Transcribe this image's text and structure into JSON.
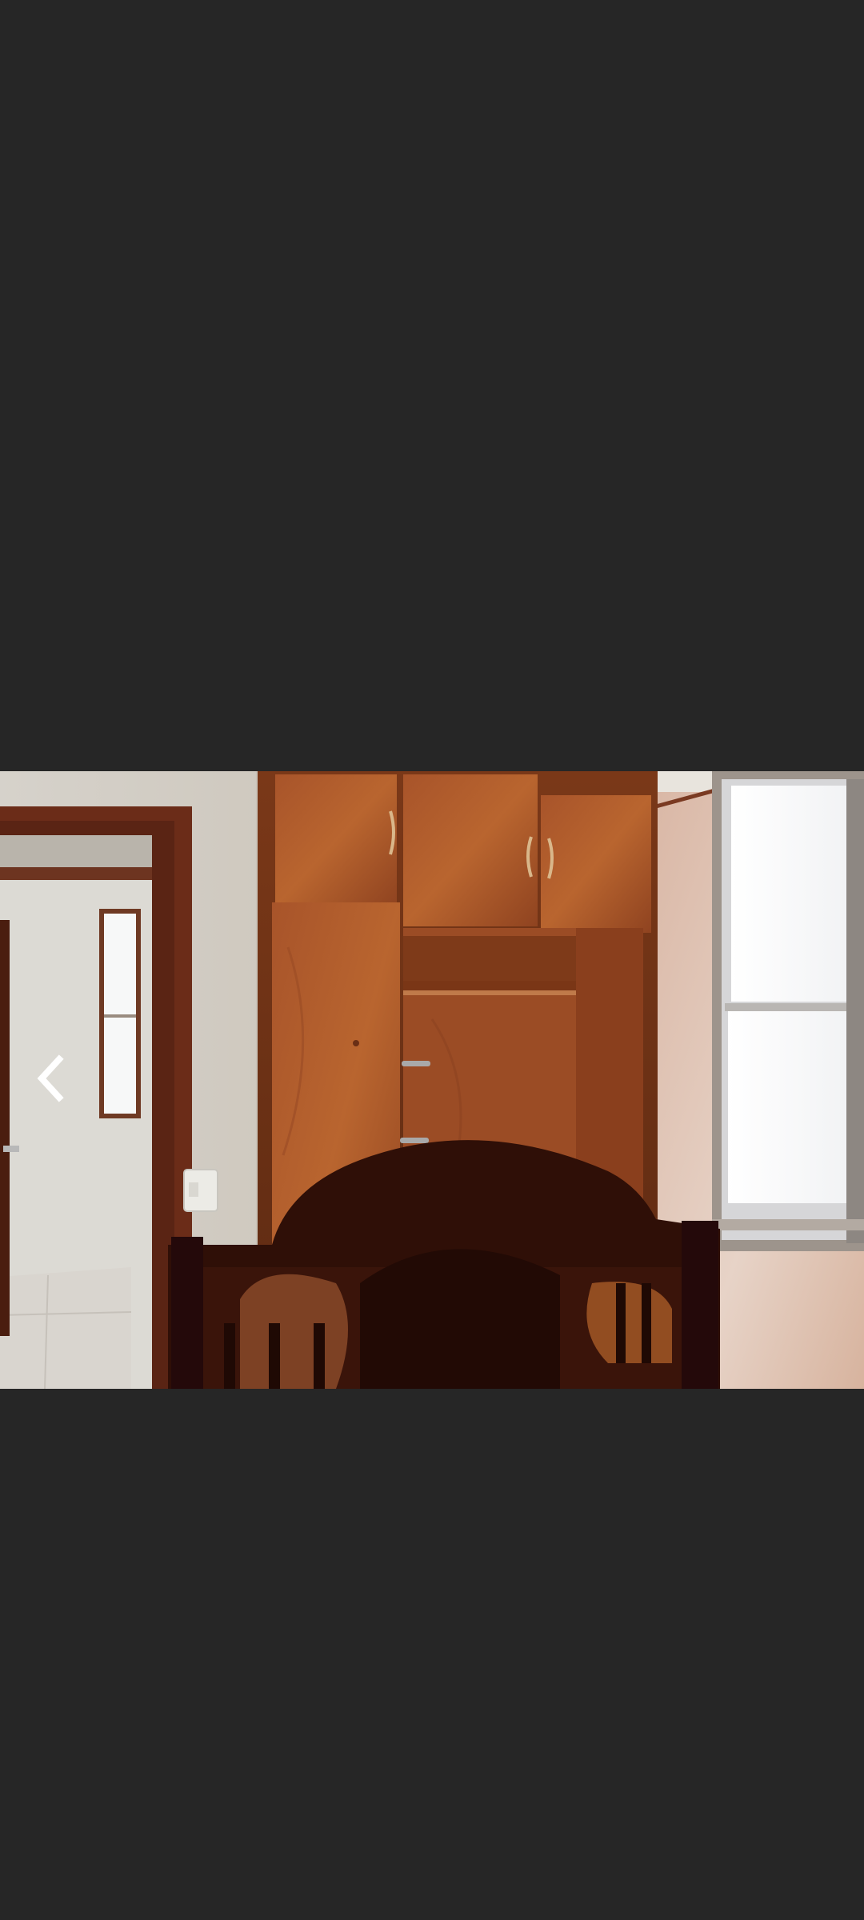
{
  "viewer": {
    "background_color": "#262626",
    "photo": {
      "subject": "bedroom-photo"
    },
    "navigation": {
      "prev_icon": "chevron-left-icon",
      "icon_color": "#ffffff"
    }
  }
}
